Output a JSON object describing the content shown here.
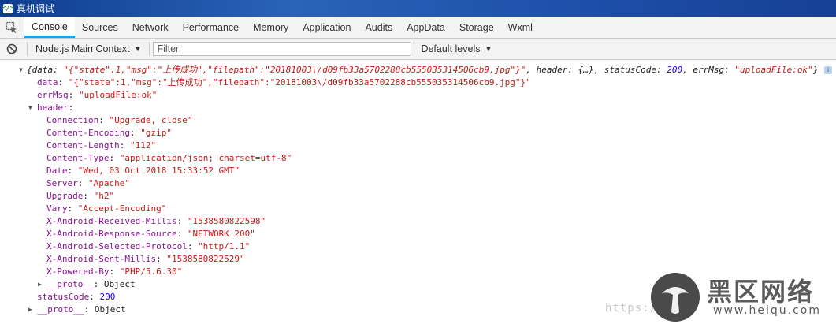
{
  "window": {
    "title": "真机调试",
    "icon": "devtools-icon"
  },
  "tabs": [
    {
      "label": "Console",
      "active": true
    },
    {
      "label": "Sources"
    },
    {
      "label": "Network"
    },
    {
      "label": "Performance"
    },
    {
      "label": "Memory"
    },
    {
      "label": "Application"
    },
    {
      "label": "Audits"
    },
    {
      "label": "AppData"
    },
    {
      "label": "Storage"
    },
    {
      "label": "Wxml"
    }
  ],
  "toolbar": {
    "context": "Node.js Main Context",
    "filter_placeholder": "Filter",
    "levels": "Default levels"
  },
  "console": {
    "summary": {
      "open": "{data: ",
      "data_val": "\"{\"state\":1,\"msg\":\"上传成功\",\"filepath\":\"20181003\\/d09fb33a5702288cb555035314506cb9.jpg\"}\"",
      "mid1": ", header: {…}, statusCode: ",
      "status_val": "200",
      "mid2": ", errMsg: ",
      "errmsg_val": "\"uploadFile:ok\"",
      "close": "}"
    },
    "data": {
      "key": "data",
      "value": "\"{\"state\":1,\"msg\":\"上传成功\",\"filepath\":\"20181003\\/d09fb33a5702288cb555035314506cb9.jpg\"}\""
    },
    "errMsg": {
      "key": "errMsg",
      "value": "\"uploadFile:ok\""
    },
    "header_key": "header",
    "headers": [
      {
        "key": "Connection",
        "value": "\"Upgrade, close\""
      },
      {
        "key": "Content-Encoding",
        "value": "\"gzip\""
      },
      {
        "key": "Content-Length",
        "value": "\"112\""
      },
      {
        "key": "Content-Type",
        "value": "\"application/json; charset=utf-8\""
      },
      {
        "key": "Date",
        "value": "\"Wed, 03 Oct 2018 15:33:52 GMT\""
      },
      {
        "key": "Server",
        "value": "\"Apache\""
      },
      {
        "key": "Upgrade",
        "value": "\"h2\""
      },
      {
        "key": "Vary",
        "value": "\"Accept-Encoding\""
      },
      {
        "key": "X-Android-Received-Millis",
        "value": "\"1538580822598\""
      },
      {
        "key": "X-Android-Response-Source",
        "value": "\"NETWORK 200\""
      },
      {
        "key": "X-Android-Selected-Protocol",
        "value": "\"http/1.1\""
      },
      {
        "key": "X-Android-Sent-Millis",
        "value": "\"1538580822529\""
      },
      {
        "key": "X-Powered-By",
        "value": "\"PHP/5.6.30\""
      }
    ],
    "header_proto": {
      "key": "__proto__",
      "value": "Object"
    },
    "statusCode": {
      "key": "statusCode",
      "value": "200"
    },
    "proto": {
      "key": "__proto__",
      "value": "Object"
    },
    "info_icon": "i"
  },
  "watermark": {
    "url": "https://",
    "name": "黑区网络",
    "domain": "www.heiqu.com"
  },
  "colors": {
    "accent": "#03a9f4",
    "key": "#881391",
    "string": "#c41a16",
    "number": "#1c00cf"
  }
}
